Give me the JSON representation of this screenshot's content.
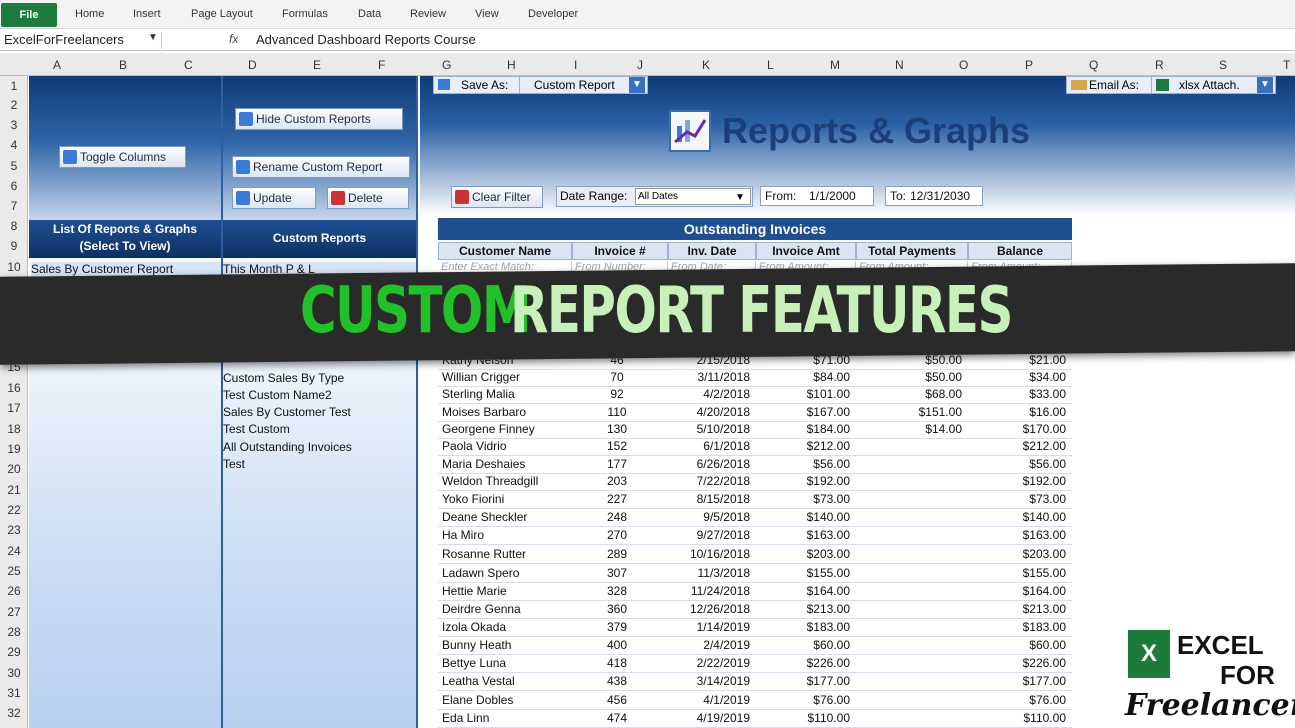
{
  "ribbon": {
    "tabs": [
      "File",
      "Home",
      "Insert",
      "Page Layout",
      "Formulas",
      "Data",
      "Review",
      "View",
      "Developer"
    ]
  },
  "formula_bar": {
    "name_box": "ExcelForFreelancers",
    "fx": "fx",
    "value": "Advanced Dashboard Reports Course"
  },
  "columns": [
    "A",
    "B",
    "C",
    "D",
    "E",
    "F",
    "G",
    "H",
    "I",
    "J",
    "K",
    "L",
    "M",
    "N",
    "O",
    "P",
    "Q",
    "R",
    "S",
    "T"
  ],
  "rows": [
    "1",
    "2",
    "3",
    "4",
    "5",
    "6",
    "7",
    "8",
    "9",
    "10",
    "15",
    "16",
    "17",
    "18",
    "19",
    "20",
    "21",
    "22",
    "23",
    "24",
    "25",
    "26",
    "27",
    "28",
    "29",
    "30",
    "31",
    "32"
  ],
  "toolbar": {
    "save_as_label": "Save As:",
    "save_as_value": "Custom Report",
    "email_as_label": "Email As:",
    "email_as_value": "xlsx Attach."
  },
  "left_panel": {
    "toggle_columns": "Toggle Columns",
    "list_header_1": "List Of Reports & Graphs",
    "list_header_2": "(Select To View)",
    "first_item": "Sales By Customer Report"
  },
  "custom_panel": {
    "hide_button": "Hide Custom Reports",
    "rename_button": "Rename Custom Report",
    "update_button": "Update",
    "delete_button": "Delete",
    "header": "Custom Reports",
    "items": [
      "This Month P & L",
      "Custom Sales By Type",
      "Test Custom Name2",
      "Sales By Customer Test",
      "Test Custom",
      "All Outstanding Invoices",
      "Test"
    ]
  },
  "title": "Reports & Graphs",
  "filters": {
    "clear_filter": "Clear Filter",
    "date_range_label": "Date Range:",
    "date_range_value": "All Dates",
    "from_label": "From:",
    "from_value": "1/1/2000",
    "to_label": "To:",
    "to_value": "12/31/2030"
  },
  "table": {
    "title": "Outstanding Invoices",
    "headers": [
      "Customer Name",
      "Invoice #",
      "Inv. Date",
      "Invoice Amt",
      "Total Payments",
      "Balance"
    ],
    "placeholders": [
      "Enter Exact Match:",
      "From Number:",
      "From Date:",
      "From Amount:",
      "From Amount:",
      "From Amount:"
    ],
    "rows": [
      [
        "Kathy Nelson",
        "46",
        "2/15/2018",
        "$71.00",
        "$50.00",
        "$21.00"
      ],
      [
        "Willian Crigger",
        "70",
        "3/11/2018",
        "$84.00",
        "$50.00",
        "$34.00"
      ],
      [
        "Sterling Malia",
        "92",
        "4/2/2018",
        "$101.00",
        "$68.00",
        "$33.00"
      ],
      [
        "Moises Barbaro",
        "110",
        "4/20/2018",
        "$167.00",
        "$151.00",
        "$16.00"
      ],
      [
        "Georgene Finney",
        "130",
        "5/10/2018",
        "$184.00",
        "$14.00",
        "$170.00"
      ],
      [
        "Paola Vidrio",
        "152",
        "6/1/2018",
        "$212.00",
        "",
        "$212.00"
      ],
      [
        "Maria Deshaies",
        "177",
        "6/26/2018",
        "$56.00",
        "",
        "$56.00"
      ],
      [
        "Weldon Threadgill",
        "203",
        "7/22/2018",
        "$192.00",
        "",
        "$192.00"
      ],
      [
        "Yoko Fiorini",
        "227",
        "8/15/2018",
        "$73.00",
        "",
        "$73.00"
      ],
      [
        "Deane Sheckler",
        "248",
        "9/5/2018",
        "$140.00",
        "",
        "$140.00"
      ],
      [
        "Ha Miro",
        "270",
        "9/27/2018",
        "$163.00",
        "",
        "$163.00"
      ],
      [
        "Rosanne Rutter",
        "289",
        "10/16/2018",
        "$203.00",
        "",
        "$203.00"
      ],
      [
        "Ladawn Spero",
        "307",
        "11/3/2018",
        "$155.00",
        "",
        "$155.00"
      ],
      [
        "Hettie Marie",
        "328",
        "11/24/2018",
        "$164.00",
        "",
        "$164.00"
      ],
      [
        "Deirdre Genna",
        "360",
        "12/26/2018",
        "$213.00",
        "",
        "$213.00"
      ],
      [
        "Izola Okada",
        "379",
        "1/14/2019",
        "$183.00",
        "",
        "$183.00"
      ],
      [
        "Bunny Heath",
        "400",
        "2/4/2019",
        "$60.00",
        "",
        "$60.00"
      ],
      [
        "Bettye Luna",
        "418",
        "2/22/2019",
        "$226.00",
        "",
        "$226.00"
      ],
      [
        "Leatha Vestal",
        "438",
        "3/14/2019",
        "$177.00",
        "",
        "$177.00"
      ],
      [
        "Elane Dobles",
        "456",
        "4/1/2019",
        "$76.00",
        "",
        "$76.00"
      ],
      [
        "Eda Linn",
        "474",
        "4/19/2019",
        "$110.00",
        "",
        "$110.00"
      ]
    ]
  },
  "banner": {
    "word1": "CUSTOM",
    "word2": "REPORT FEATURES"
  },
  "logo": {
    "x": "X",
    "line1": "EXCEL",
    "line2": "FOR",
    "line3": "Freelancers"
  }
}
